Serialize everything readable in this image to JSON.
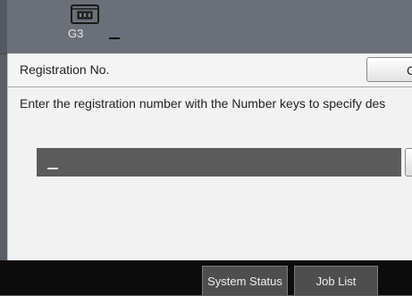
{
  "header": {
    "line_label": "G3",
    "fax_icon": "fax-machine-icon"
  },
  "dialog": {
    "title": "Registration No.",
    "cancel_label": "Can",
    "instruction": "Enter the registration number with the Number keys to specify des",
    "entry_value": ""
  },
  "bottom_bar": {
    "system_status_label": "System Status",
    "job_list_label": "Job List"
  },
  "colors": {
    "header_bg": "#6b7078",
    "dialog_bg": "#f2f2f2",
    "entry_bg": "#5b5b5b",
    "bottom_bg": "#0c0c0c"
  }
}
